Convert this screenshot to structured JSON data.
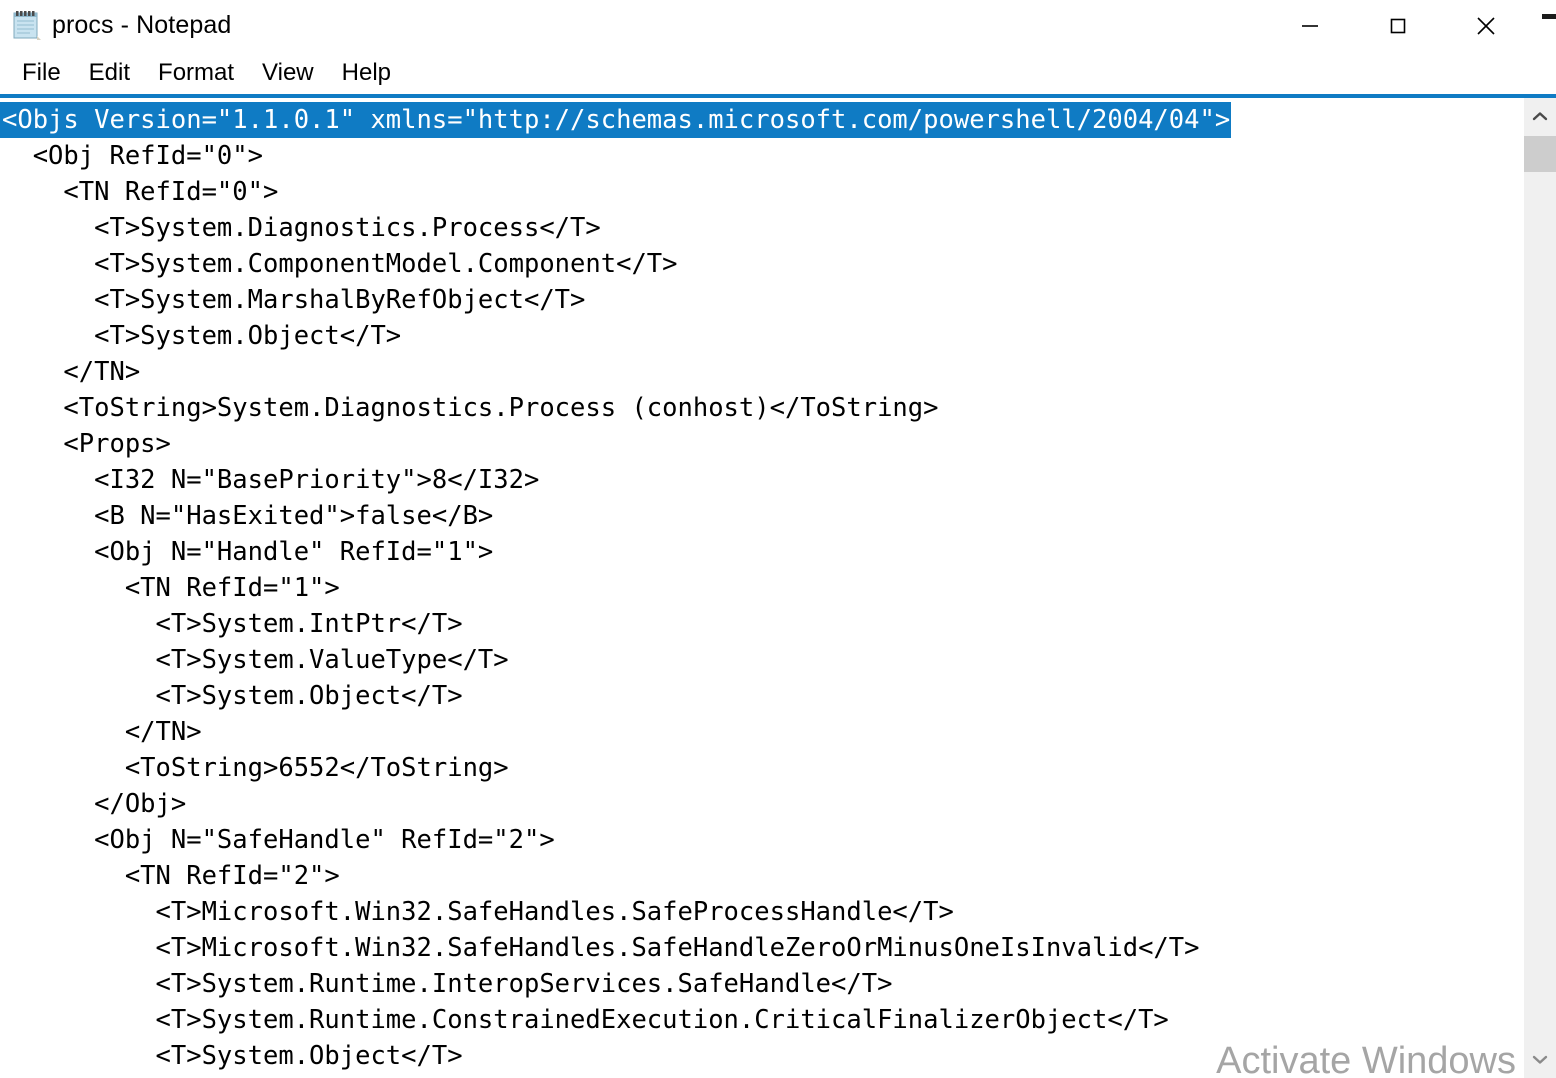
{
  "window": {
    "title": "procs - Notepad",
    "icon": "notepad-icon",
    "controls": {
      "minimize": "—",
      "maximize": "□",
      "close": "✕"
    }
  },
  "menubar": {
    "items": [
      {
        "label": "File"
      },
      {
        "label": "Edit"
      },
      {
        "label": "Format"
      },
      {
        "label": "View"
      },
      {
        "label": "Help"
      }
    ]
  },
  "editor": {
    "selected_line_index": 0,
    "selection_color": "#0f7bc4",
    "selection_text_color": "#ffffff",
    "text_color": "#000000",
    "background_color": "#ffffff",
    "lines": [
      "<Objs Version=\"1.1.0.1\" xmlns=\"http://schemas.microsoft.com/powershell/2004/04\">",
      "  <Obj RefId=\"0\">",
      "    <TN RefId=\"0\">",
      "      <T>System.Diagnostics.Process</T>",
      "      <T>System.ComponentModel.Component</T>",
      "      <T>System.MarshalByRefObject</T>",
      "      <T>System.Object</T>",
      "    </TN>",
      "    <ToString>System.Diagnostics.Process (conhost)</ToString>",
      "    <Props>",
      "      <I32 N=\"BasePriority\">8</I32>",
      "      <B N=\"HasExited\">false</B>",
      "      <Obj N=\"Handle\" RefId=\"1\">",
      "        <TN RefId=\"1\">",
      "          <T>System.IntPtr</T>",
      "          <T>System.ValueType</T>",
      "          <T>System.Object</T>",
      "        </TN>",
      "        <ToString>6552</ToString>",
      "      </Obj>",
      "      <Obj N=\"SafeHandle\" RefId=\"2\">",
      "        <TN RefId=\"2\">",
      "          <T>Microsoft.Win32.SafeHandles.SafeProcessHandle</T>",
      "          <T>Microsoft.Win32.SafeHandles.SafeHandleZeroOrMinusOneIsInvalid</T>",
      "          <T>System.Runtime.InteropServices.SafeHandle</T>",
      "          <T>System.Runtime.ConstrainedExecution.CriticalFinalizerObject</T>",
      "          <T>System.Object</T>"
    ]
  },
  "scrollbar": {
    "up_arrow": "scroll-up-icon",
    "down_arrow": "scroll-down-icon",
    "thumb_position_pct": 0,
    "thumb_size_pct": 4
  },
  "watermark": {
    "title": "Activate Windows",
    "subtitle": ""
  }
}
